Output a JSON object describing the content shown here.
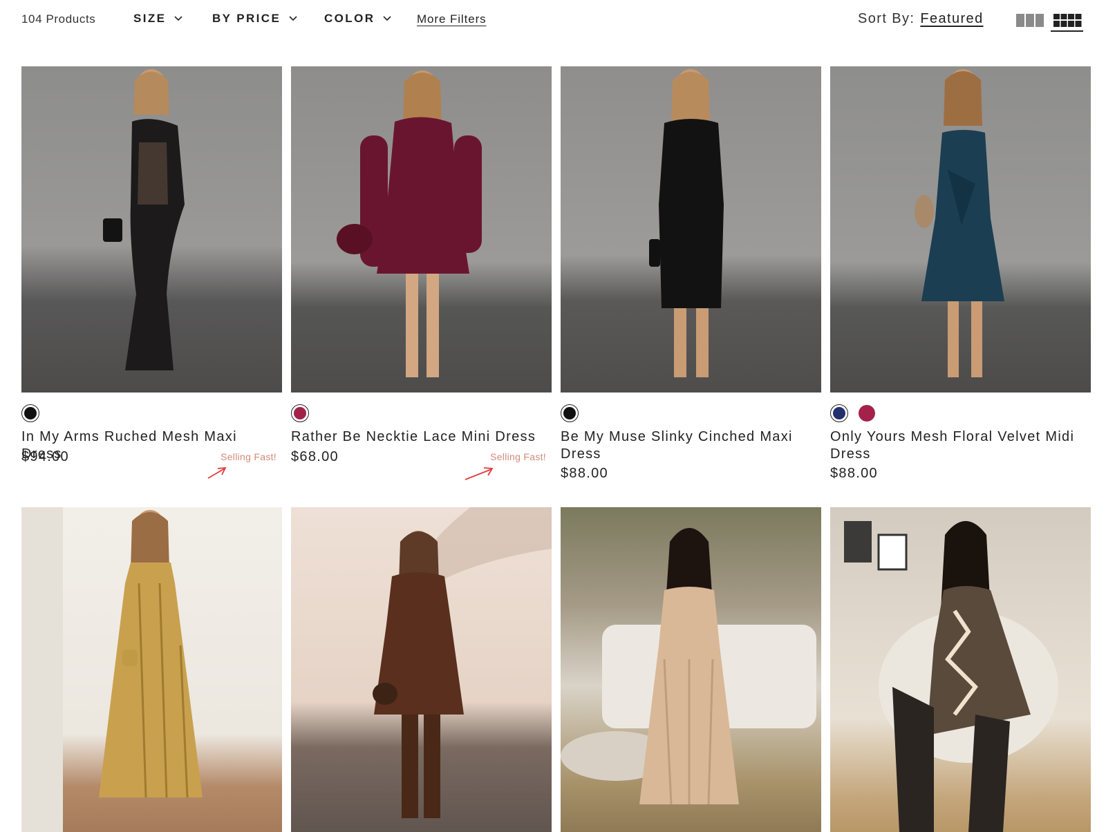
{
  "toolbar": {
    "product_count": "104 Products",
    "filters": {
      "size": "SIZE",
      "price": "BY PRICE",
      "color": "COLOR"
    },
    "more_filters": "More Filters",
    "sort_label": "Sort By:",
    "sort_value": "Featured",
    "view_icons": [
      "grid-3-icon",
      "grid-4-icon"
    ],
    "active_view": "grid-4"
  },
  "products": [
    {
      "name": "In My Arms Ruched Mesh Maxi Dress",
      "price": "$94.00",
      "badge": "Selling Fast!",
      "swatches": [
        "#111111"
      ]
    },
    {
      "name": "Rather Be Necktie Lace Mini Dress",
      "price": "$68.00",
      "badge": "Selling Fast!",
      "swatches": [
        "#a3224a"
      ]
    },
    {
      "name": "Be My Muse Slinky Cinched Maxi Dress",
      "price": "$88.00",
      "badge": "",
      "swatches": [
        "#111111"
      ]
    },
    {
      "name": "Only Yours Mesh Floral Velvet Midi Dress",
      "price": "$88.00",
      "badge": "",
      "swatches": [
        "#22306e",
        "#a3224a"
      ]
    }
  ],
  "colors": {
    "text": "#222222",
    "badge": "#d08a7b",
    "arrow": "#e23a3a"
  }
}
